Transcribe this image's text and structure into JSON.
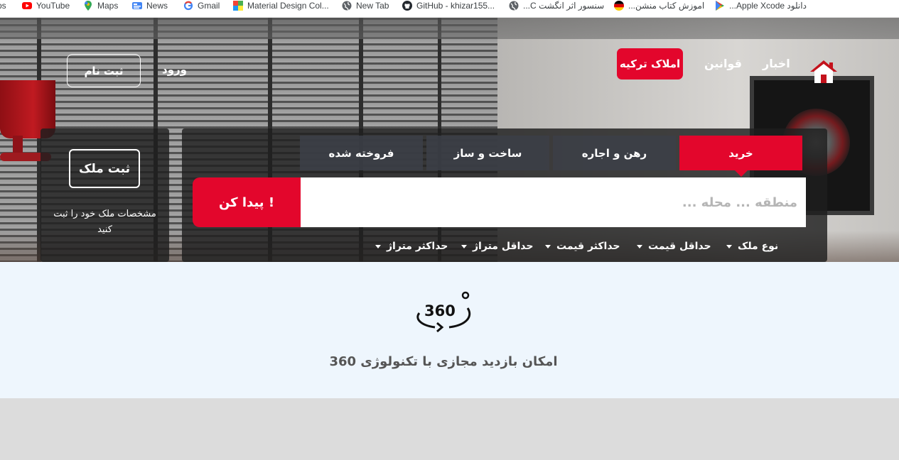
{
  "bookmarks": [
    {
      "label": "ps",
      "icon": "apps-icon"
    },
    {
      "label": "YouTube",
      "icon": "youtube-icon",
      "color": "#ff0000"
    },
    {
      "label": "Maps",
      "icon": "maps-icon"
    },
    {
      "label": "News",
      "icon": "news-icon"
    },
    {
      "label": "Gmail",
      "icon": "google-icon"
    },
    {
      "label": "Material Design Col...",
      "icon": "palette-icon"
    },
    {
      "label": "New Tab",
      "icon": "globe-icon"
    },
    {
      "label": "GitHub - khizar155...",
      "icon": "github-icon"
    },
    {
      "label": "سنسور اثر انگشت C...",
      "icon": "globe-icon"
    },
    {
      "label": "اموزش کتاب منشن...",
      "icon": "flag-de-icon"
    },
    {
      "label": "دانلود Apple Xcode...",
      "icon": "play-icon"
    }
  ],
  "nav": {
    "news": "اخبار",
    "rules": "قوانین",
    "turkey_property": "املاک ترکیه",
    "login": "ورود",
    "signup": "ثبت نام"
  },
  "register": {
    "button": "ثبت ملک",
    "text": "مشخصات ملک خود را ثبت کنید"
  },
  "search": {
    "tabs": [
      "خرید",
      "رهن و اجاره",
      "ساخت و ساز",
      "فروخته شده"
    ],
    "active_tab": "خرید",
    "placeholder": "منطقه ... محله ...",
    "value": "",
    "find_button": "پیدا کن !",
    "filters": [
      "نوع ملک",
      "حداقل قیمت",
      "حداکثر قیمت",
      "حداقل متراژ",
      "حداکثر متراژ"
    ]
  },
  "feature": {
    "icon": "360-icon",
    "text": "امکان بازدید مجازی با تکنولوژی 360"
  },
  "colors": {
    "accent": "#e3062c",
    "panel": "#1e1e1e",
    "feature_bg": "#eef6fd"
  }
}
